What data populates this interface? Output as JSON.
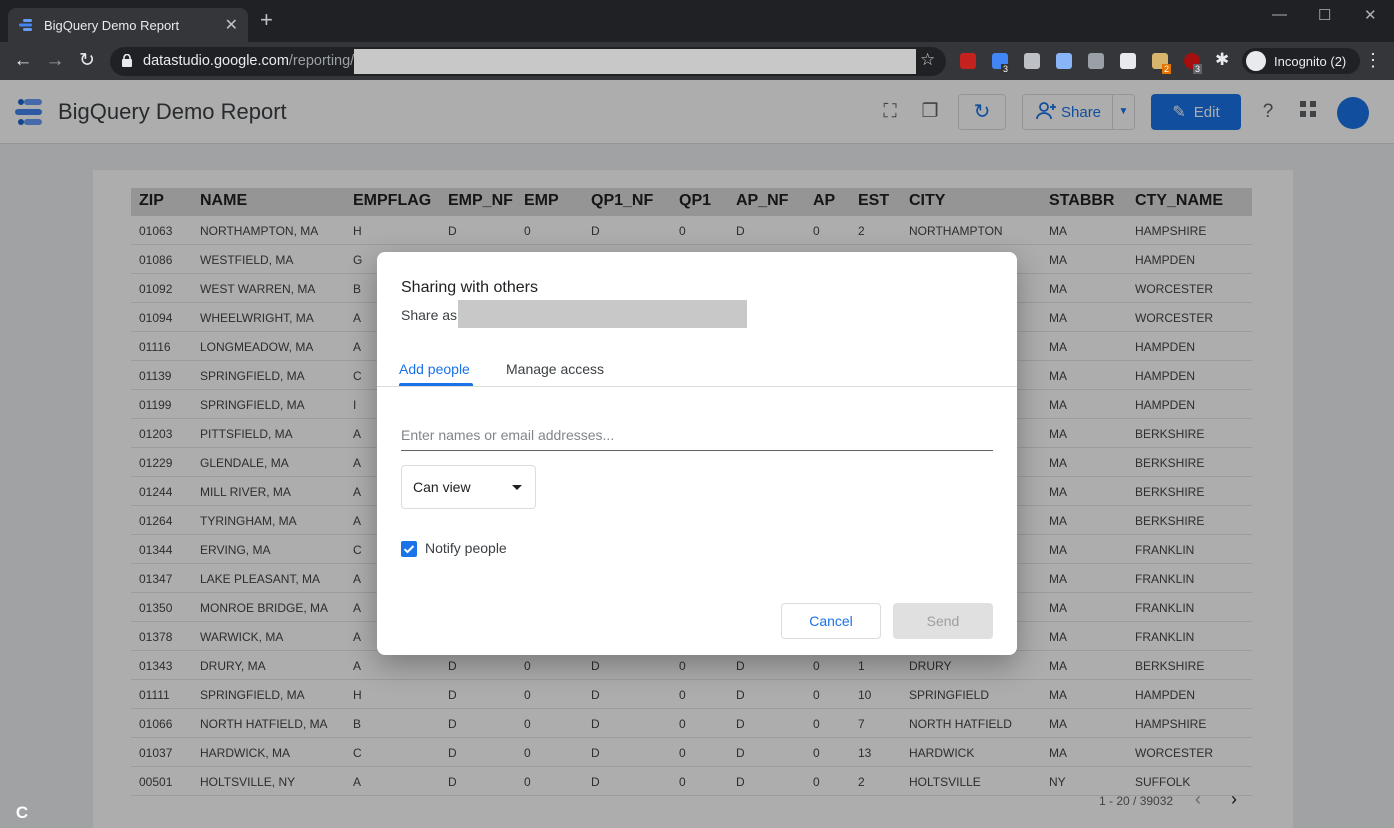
{
  "browser": {
    "tab_title": "BigQuery Demo Report",
    "close_tab": "✕",
    "new_tab": "+",
    "url_domain": "datastudio.google.com",
    "url_path": "/reporting/",
    "incognito_label": "Incognito (2)",
    "ext_badges": [
      "3",
      "2",
      "3"
    ]
  },
  "app": {
    "title": "BigQuery Demo Report",
    "share_label": "Share",
    "edit_label": "Edit",
    "accent": "#1a73e8"
  },
  "table": {
    "columns": [
      "ZIP",
      "NAME",
      "EMPFLAG",
      "EMP_NF",
      "EMP",
      "QP1_NF",
      "QP1",
      "AP_NF",
      "AP",
      "EST",
      "CITY",
      "STABBR",
      "CTY_NAME"
    ],
    "rows": [
      [
        "01063",
        "NORTHAMPTON, MA",
        "H",
        "D",
        "0",
        "D",
        "0",
        "D",
        "0",
        "2",
        "NORTHAMPTON",
        "MA",
        "HAMPSHIRE"
      ],
      [
        "01086",
        "WESTFIELD, MA",
        "G",
        "",
        "",
        "",
        "",
        "",
        "",
        "",
        "",
        "MA",
        "HAMPDEN"
      ],
      [
        "01092",
        "WEST WARREN, MA",
        "B",
        "",
        "",
        "",
        "",
        "",
        "",
        "",
        "",
        "MA",
        "WORCESTER"
      ],
      [
        "01094",
        "WHEELWRIGHT, MA",
        "A",
        "",
        "",
        "",
        "",
        "",
        "",
        "",
        "",
        "MA",
        "WORCESTER"
      ],
      [
        "01116",
        "LONGMEADOW, MA",
        "A",
        "",
        "",
        "",
        "",
        "",
        "",
        "",
        "",
        "MA",
        "HAMPDEN"
      ],
      [
        "01139",
        "SPRINGFIELD, MA",
        "C",
        "",
        "",
        "",
        "",
        "",
        "",
        "",
        "",
        "MA",
        "HAMPDEN"
      ],
      [
        "01199",
        "SPRINGFIELD, MA",
        "I",
        "",
        "",
        "",
        "",
        "",
        "",
        "",
        "",
        "MA",
        "HAMPDEN"
      ],
      [
        "01203",
        "PITTSFIELD, MA",
        "A",
        "",
        "",
        "",
        "",
        "",
        "",
        "",
        "",
        "MA",
        "BERKSHIRE"
      ],
      [
        "01229",
        "GLENDALE, MA",
        "A",
        "",
        "",
        "",
        "",
        "",
        "",
        "",
        "",
        "MA",
        "BERKSHIRE"
      ],
      [
        "01244",
        "MILL RIVER, MA",
        "A",
        "",
        "",
        "",
        "",
        "",
        "",
        "",
        "",
        "MA",
        "BERKSHIRE"
      ],
      [
        "01264",
        "TYRINGHAM, MA",
        "A",
        "",
        "",
        "",
        "",
        "",
        "",
        "",
        "",
        "MA",
        "BERKSHIRE"
      ],
      [
        "01344",
        "ERVING, MA",
        "C",
        "",
        "",
        "",
        "",
        "",
        "",
        "",
        "",
        "MA",
        "FRANKLIN"
      ],
      [
        "01347",
        "LAKE PLEASANT, MA",
        "A",
        "",
        "",
        "",
        "",
        "",
        "",
        "",
        "",
        "MA",
        "FRANKLIN"
      ],
      [
        "01350",
        "MONROE BRIDGE, MA",
        "A",
        "",
        "",
        "",
        "",
        "",
        "",
        "",
        "",
        "MA",
        "FRANKLIN"
      ],
      [
        "01378",
        "WARWICK, MA",
        "A",
        "",
        "",
        "",
        "",
        "",
        "",
        "",
        "",
        "MA",
        "FRANKLIN"
      ],
      [
        "01343",
        "DRURY, MA",
        "A",
        "D",
        "0",
        "D",
        "0",
        "D",
        "0",
        "1",
        "DRURY",
        "MA",
        "BERKSHIRE"
      ],
      [
        "01111",
        "SPRINGFIELD, MA",
        "H",
        "D",
        "0",
        "D",
        "0",
        "D",
        "0",
        "10",
        "SPRINGFIELD",
        "MA",
        "HAMPDEN"
      ],
      [
        "01066",
        "NORTH HATFIELD, MA",
        "B",
        "D",
        "0",
        "D",
        "0",
        "D",
        "0",
        "7",
        "NORTH HATFIELD",
        "MA",
        "HAMPSHIRE"
      ],
      [
        "01037",
        "HARDWICK, MA",
        "C",
        "D",
        "0",
        "D",
        "0",
        "D",
        "0",
        "13",
        "HARDWICK",
        "MA",
        "WORCESTER"
      ],
      [
        "00501",
        "HOLTSVILLE, NY",
        "A",
        "D",
        "0",
        "D",
        "0",
        "D",
        "0",
        "2",
        "HOLTSVILLE",
        "NY",
        "SUFFOLK"
      ]
    ],
    "pagination": "1 - 20 / 39032"
  },
  "dialog": {
    "title": "Sharing with others",
    "share_as_label": "Share as",
    "tab_add": "Add people",
    "tab_manage": "Manage access",
    "input_placeholder": "Enter names or email addresses...",
    "permission": "Can view",
    "notify_label": "Notify people",
    "notify_checked": true,
    "cancel_label": "Cancel",
    "send_label": "Send"
  },
  "corner_badge": "C"
}
